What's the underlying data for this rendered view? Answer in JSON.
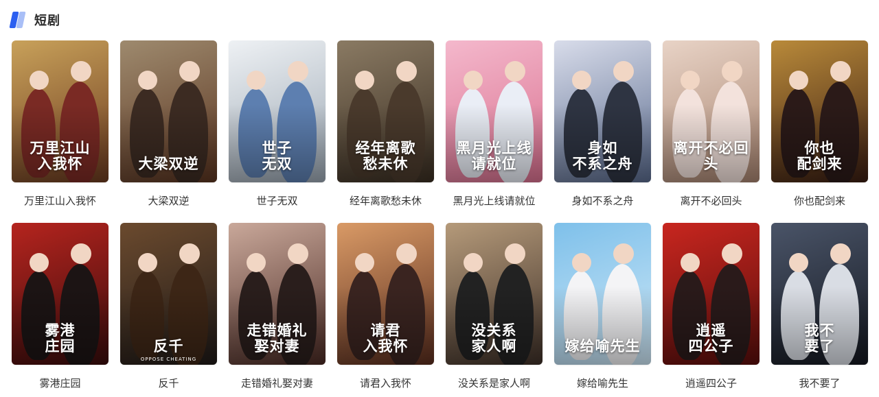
{
  "section": {
    "title": "短剧",
    "icon": "section-mark-icon"
  },
  "dramas": [
    {
      "title": "万里江山入我怀",
      "poster_text": "万里江山\n入我怀",
      "poster_sub": "",
      "colors": [
        "#c8a15a",
        "#6b3a1f"
      ],
      "figure": "#7a2a24"
    },
    {
      "title": "大梁双逆",
      "poster_text": "大梁双逆",
      "poster_sub": "",
      "colors": [
        "#9e8a6e",
        "#5a3420"
      ],
      "figure": "#3c2b22"
    },
    {
      "title": "世子无双",
      "poster_text": "世子\n无双",
      "poster_sub": "",
      "colors": [
        "#eef1f4",
        "#9aa6b2"
      ],
      "figure": "#5d7fb0"
    },
    {
      "title": "经年离歌愁未休",
      "poster_text": "经年离歌\n愁未休",
      "poster_sub": "",
      "colors": [
        "#8a7a63",
        "#3a2e22"
      ],
      "figure": "#4a3a2c"
    },
    {
      "title": "黑月光上线请就位",
      "poster_text": "黑月光上线\n请就位",
      "poster_sub": "",
      "colors": [
        "#f4b8cc",
        "#d9708f"
      ],
      "figure": "#eaeef6"
    },
    {
      "title": "身如不系之舟",
      "poster_text": "身如\n不系之舟",
      "poster_sub": "",
      "colors": [
        "#d8dcea",
        "#5a6b8e"
      ],
      "figure": "#2e3442"
    },
    {
      "title": "离开不必回头",
      "poster_text": "离开不必回头",
      "poster_sub": "",
      "colors": [
        "#e8d3c6",
        "#a88470"
      ],
      "figure": "#f3e2dc"
    },
    {
      "title": "你也配剑来",
      "poster_text": "你也\n配剑来",
      "poster_sub": "",
      "colors": [
        "#b98a3a",
        "#3a1d12"
      ],
      "figure": "#2b1a18"
    },
    {
      "title": "雾港庄园",
      "poster_text": "雾港\n庄园",
      "poster_sub": "",
      "colors": [
        "#b5241e",
        "#3a0c0c"
      ],
      "figure": "#1c1414"
    },
    {
      "title": "反千",
      "poster_text": "反千",
      "poster_sub": "OPPOSE CHEATING",
      "colors": [
        "#6b4a2e",
        "#1f1a18"
      ],
      "figure": "#3d2616"
    },
    {
      "title": "走错婚礼娶对妻",
      "poster_text": "走错婚礼\n娶对妻",
      "poster_sub": "",
      "colors": [
        "#c9a89a",
        "#4a2a24"
      ],
      "figure": "#2a1e1c"
    },
    {
      "title": "请君入我怀",
      "poster_text": "请君\n入我怀",
      "poster_sub": "",
      "colors": [
        "#d99a66",
        "#5a2d1e"
      ],
      "figure": "#3a2420"
    },
    {
      "title": "没关系是家人啊",
      "poster_text": "没关系\n家人啊",
      "poster_sub": "",
      "colors": [
        "#b59a7a",
        "#3e3028"
      ],
      "figure": "#222222"
    },
    {
      "title": "嫁给喻先生",
      "poster_text": "嫁给喻先生",
      "poster_sub": "",
      "colors": [
        "#7ec0ea",
        "#cfe8f7"
      ],
      "figure": "#f4f4f6"
    },
    {
      "title": "逍遥四公子",
      "poster_text": "逍遥\n四公子",
      "poster_sub": "",
      "colors": [
        "#c8261f",
        "#5a0e0c"
      ],
      "figure": "#2a1a1a"
    },
    {
      "title": "我不要了",
      "poster_text": "我不\n要了",
      "poster_sub": "",
      "colors": [
        "#4a5468",
        "#141820"
      ],
      "figure": "#d9dde4"
    }
  ]
}
